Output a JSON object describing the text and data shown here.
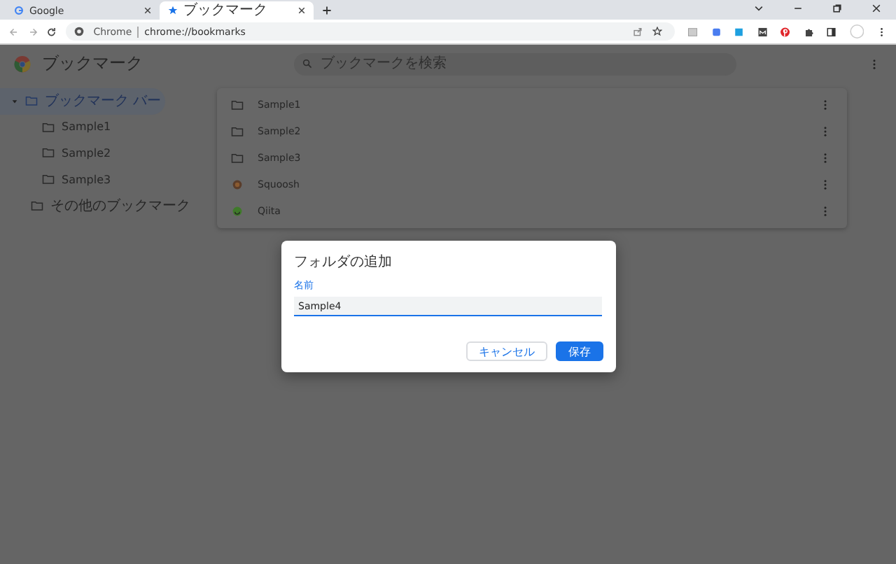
{
  "tabs": [
    {
      "kind": "google",
      "title": "Google",
      "selected": false
    },
    {
      "kind": "star",
      "title": "ブックマーク",
      "selected": true
    }
  ],
  "address": {
    "site_label": "Chrome",
    "url": "chrome://bookmarks"
  },
  "app": {
    "title": "ブックマーク",
    "search_placeholder": "ブックマークを検索"
  },
  "sidebar": {
    "items": [
      {
        "label": "ブックマーク バー",
        "selected": true,
        "expanded": true,
        "children": [
          {
            "label": "Sample1",
            "selected": false
          },
          {
            "label": "Sample2",
            "selected": false
          },
          {
            "label": "Sample3",
            "selected": false
          }
        ]
      },
      {
        "label": "その他のブックマーク",
        "selected": false
      }
    ]
  },
  "list": {
    "items": [
      {
        "kind": "folder",
        "label": "Sample1"
      },
      {
        "kind": "folder",
        "label": "Sample2"
      },
      {
        "kind": "folder",
        "label": "Sample3"
      },
      {
        "kind": "site-brown",
        "label": "Squoosh"
      },
      {
        "kind": "site-green",
        "label": "Qiita"
      }
    ]
  },
  "dialog": {
    "title": "フォルダの追加",
    "field_label": "名前",
    "value": "Sample4",
    "buttons": [
      {
        "kind": "secondary",
        "label": "キャンセル"
      },
      {
        "kind": "primary",
        "label": "保存"
      }
    ]
  }
}
